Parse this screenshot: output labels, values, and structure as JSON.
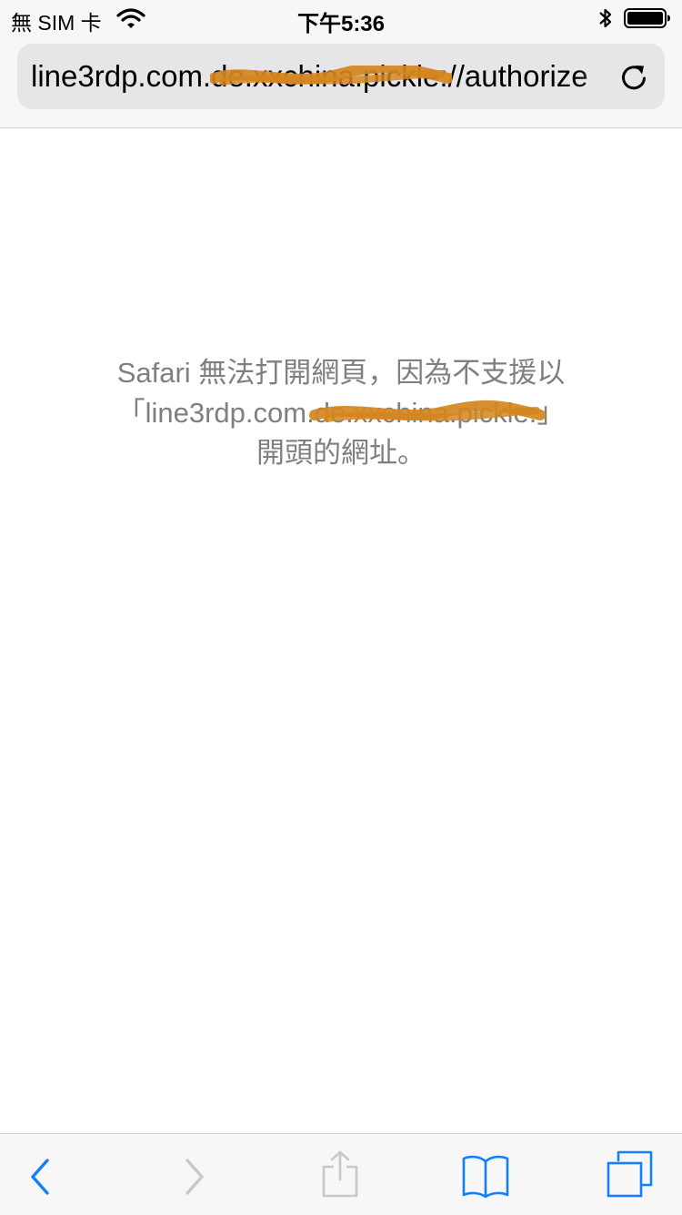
{
  "status_bar": {
    "carrier": "無 SIM 卡",
    "time": "下午5:36"
  },
  "address_bar": {
    "url_text": "line3rdp.com.de.xxchina.pickle://authorize"
  },
  "error": {
    "line1": "Safari 無法打開網頁，因為不支援以",
    "line2": "「line3rdp.com.de.xxchina.pickle:」",
    "line3": "開頭的網址。"
  },
  "toolbar": {
    "icons": [
      "back-icon",
      "forward-icon",
      "share-icon",
      "bookmarks-icon",
      "tabs-icon"
    ]
  },
  "colors": {
    "accent": "#157efb",
    "disabled": "#c7c7cc",
    "message_text": "#7f7f7f",
    "redaction": "#d4861e"
  }
}
